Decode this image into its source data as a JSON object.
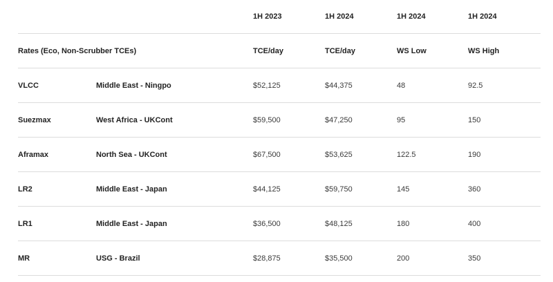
{
  "header": {
    "periods": [
      "1H 2023",
      "1H 2024",
      "1H 2024",
      "1H 2024"
    ],
    "rates_label": "Rates (Eco, Non-Scrubber TCEs)",
    "metrics": [
      "TCE/day",
      "TCE/day",
      "WS Low",
      "WS High"
    ]
  },
  "rows": [
    {
      "vessel": "VLCC",
      "route": "Middle East - Ningpo",
      "tce_2023": "$52,125",
      "tce_2024": "$44,375",
      "ws_low": "48",
      "ws_high": "92.5"
    },
    {
      "vessel": "Suezmax",
      "route": "West Africa - UKCont",
      "tce_2023": "$59,500",
      "tce_2024": "$47,250",
      "ws_low": "95",
      "ws_high": "150"
    },
    {
      "vessel": "Aframax",
      "route": "North Sea - UKCont",
      "tce_2023": "$67,500",
      "tce_2024": "$53,625",
      "ws_low": "122.5",
      "ws_high": "190"
    },
    {
      "vessel": "LR2",
      "route": "Middle East - Japan",
      "tce_2023": "$44,125",
      "tce_2024": "$59,750",
      "ws_low": "145",
      "ws_high": "360"
    },
    {
      "vessel": "LR1",
      "route": "Middle East - Japan",
      "tce_2023": "$36,500",
      "tce_2024": "$48,125",
      "ws_low": "180",
      "ws_high": "400"
    },
    {
      "vessel": "MR",
      "route": "USG - Brazil",
      "tce_2023": "$28,875",
      "tce_2024": "$35,500",
      "ws_low": "200",
      "ws_high": "350"
    }
  ]
}
